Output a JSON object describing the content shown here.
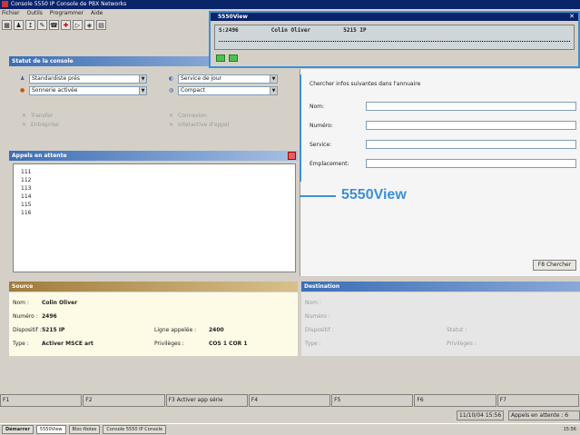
{
  "app": {
    "title": "Console 5550 IP Console de PBX Networks",
    "menu": [
      "Fichier",
      "Outils",
      "Programmer",
      "Aide"
    ]
  },
  "status_panel": {
    "heading": "Statut de la console",
    "mode_select": "Standardiste prés",
    "service_select": "Service de jour",
    "sonnerie_select": "Sonnerie activée",
    "compact_select": "Compact",
    "transfer": "Transfer",
    "entreprise": "Entreprise",
    "connexion": "Connexion",
    "interactive": "Interactive d'appel"
  },
  "queue": {
    "heading": "Appels en attente",
    "items": [
      "111",
      "112",
      "113",
      "114",
      "115",
      "116"
    ]
  },
  "search": {
    "caption": "Chercher infos suivantes dans l'annuaire",
    "labels": [
      "Nom:",
      "Numéro:",
      "Service:",
      "Emplacement:"
    ],
    "button": "F8 Chercher"
  },
  "view5550": {
    "title": "5550View",
    "line1": "S:2496          Colin Oliver          5215 IP",
    "callout": "5550View"
  },
  "source": {
    "heading": "Source",
    "rows": [
      {
        "label": "Nom :",
        "value": "Colin Oliver"
      },
      {
        "label": "Numéro :",
        "value": "2496"
      },
      {
        "label": "Dispositif :",
        "value": "5215 IP"
      },
      {
        "label": "Type :",
        "value": "Activer MSCE art"
      }
    ],
    "ligne_label": "Ligne appelée :",
    "ligne_value": "2400",
    "priv_label": "Privilèges :",
    "priv_value": "COS 1 COR 1"
  },
  "destination": {
    "heading": "Destination",
    "labels": [
      "Nom :",
      "Numéro :",
      "Dispositif :",
      "Type :"
    ],
    "statut": "Statut :",
    "privileges": "Privilèges :"
  },
  "fkeys": [
    "F1",
    "F2",
    "F3 Activer app série",
    "F4",
    "F5",
    "F6",
    "F7"
  ],
  "status": {
    "datetime": "11/10/04 15:56",
    "queue": "Appels en attente : 6"
  },
  "taskbar": {
    "start": "Démarrer",
    "tasks": [
      "5550View",
      "Bloc-Notes",
      "Console 5550 IP Console"
    ],
    "clock": "15:56"
  }
}
